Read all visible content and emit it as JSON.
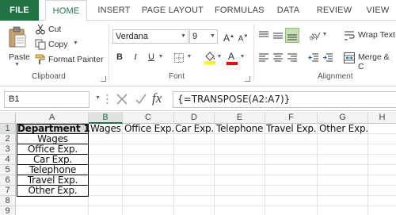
{
  "ribbon_tabs": [
    "FILE",
    "HOME",
    "INSERT",
    "PAGE LAYOUT",
    "FORMULAS",
    "DATA",
    "REVIEW",
    "VIEW"
  ],
  "clipboard": {
    "paste": "Paste",
    "cut": "Cut",
    "copy": "Copy",
    "format_painter": "Format Painter",
    "group_label": "Clipboard"
  },
  "font": {
    "name": "Verdana",
    "size": "9",
    "bold": "B",
    "italic": "I",
    "underline": "U",
    "group_label": "Font",
    "font_color": "#ff0000",
    "fill_color": "#ffff00"
  },
  "alignment": {
    "wrap_text": "Wrap Text",
    "merge": "Merge & C",
    "group_label": "Alignment"
  },
  "formula_bar": {
    "name_box": "B1",
    "formula": "{=TRANSPOSE(A2:A7)}",
    "fx": "fx"
  },
  "grid": {
    "column_headers": [
      "A",
      "B",
      "C",
      "D",
      "E",
      "F",
      "G",
      "H"
    ],
    "row_headers": [
      "1",
      "2",
      "3",
      "4",
      "5",
      "6",
      "7",
      "8",
      "9"
    ],
    "column_a": [
      "Department 1",
      "Wages",
      "Office Exp.",
      "Car Exp.",
      "Telephone",
      "Travel Exp.",
      "Other Exp."
    ],
    "row_1": [
      "Wages",
      "Office Exp.",
      "Car Exp.",
      "Telephone",
      "Travel Exp.",
      "Other Exp."
    ]
  },
  "colors": {
    "accent": "#217346",
    "header_fill": "#d9d9d9"
  }
}
